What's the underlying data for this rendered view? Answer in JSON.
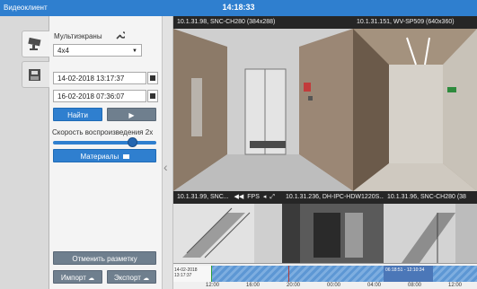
{
  "window": {
    "title": "Видеоклиент",
    "clock": "14:18:33"
  },
  "panel": {
    "multiscreen_label": "Мультиэкраны",
    "layout_value": "4x4",
    "start_datetime": "14-02-2018 13:17:37",
    "end_datetime": "16-02-2018 07:36:07",
    "find_label": "Найти",
    "play_symbol": "▶",
    "speed_label": "Скорость воспроизведения 2x",
    "playback_speed": 2,
    "materials_label": "Материалы",
    "cancel_marking_label": "Отменить разметку",
    "import_label": "Импорт",
    "export_label": "Экспорт"
  },
  "cameras": [
    {
      "title": "10.1.31.98, SNC-CH280 (384x288)"
    },
    {
      "title": "10.1.31.151, WV-SP509 (640x360)"
    },
    {
      "title": "10.1.31.99, SNC...",
      "fps_label": "FPS"
    },
    {
      "title": "10.1.31.236, DH-IPC-HDW1220S..."
    },
    {
      "title": "10.1.31.96, SNC-CH280 (38"
    }
  ],
  "timeline": {
    "start_label": "13:17:37",
    "start_date": "14-02-2018",
    "range_label": "06:18:51 - 12:10:34",
    "ticks": [
      "12:00",
      "16:00",
      "20:00",
      "00:00",
      "04:00",
      "08:00",
      "12:00"
    ]
  },
  "colors": {
    "accent": "#2f7fcf",
    "titlebar": "#2f7fcf",
    "recording": "#6fa3d8"
  }
}
